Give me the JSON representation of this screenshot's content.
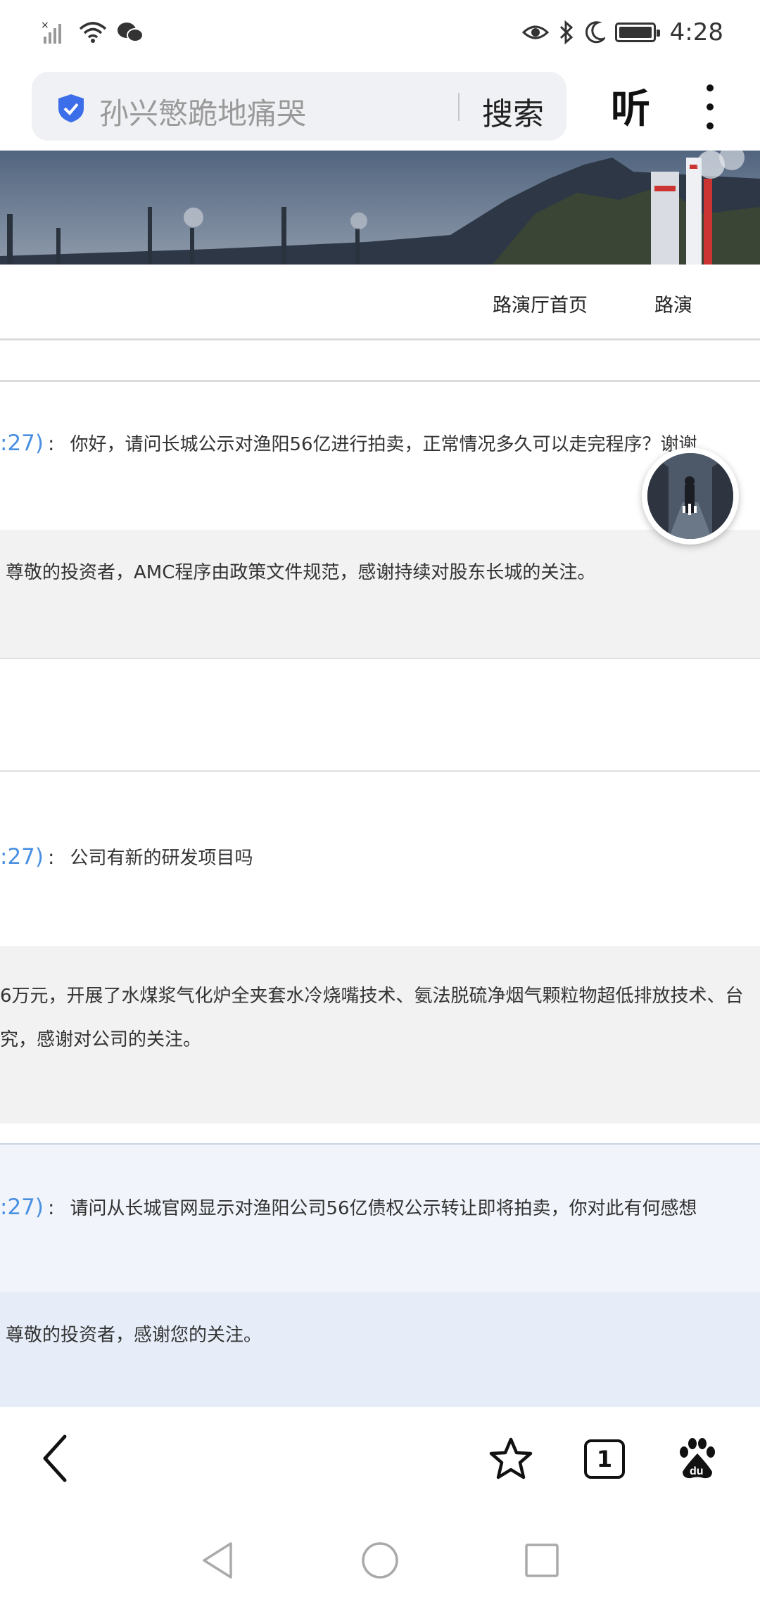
{
  "status_bar": {
    "time": "4:28",
    "left_icons": [
      "signal-icon",
      "wifi-icon",
      "wechat-icon"
    ],
    "right_icons": [
      "eye-icon",
      "bluetooth-icon",
      "moon-icon",
      "battery-icon"
    ]
  },
  "search": {
    "query": "孙兴慜跪地痛哭",
    "button_label": "搜索",
    "listen_label": "听"
  },
  "nav": {
    "items": [
      "路演厅首页",
      "路演"
    ]
  },
  "qa": [
    {
      "id": ":27)",
      "colon": ":",
      "question": "你好，请问长城公示对渔阳56亿进行拍卖，正常情况多久可以走完程序？谢谢",
      "answer_lines": [
        "尊敬的投资者，AMC程序由政策文件规范，感谢持续对股东长城的关注。"
      ]
    },
    {
      "id": ":27)",
      "colon": ":",
      "question": "公司有新的研发项目吗",
      "answer_lines": [
        "6万元，开展了水煤浆气化炉全夹套水冷烧嘴技术、氨法脱硫净烟气颗粒物超低排放技术、台",
        "究，感谢对公司的关注。"
      ]
    },
    {
      "id": ":27)",
      "colon": ":",
      "question": "请问从长城官网显示对渔阳公司56亿债权公示转让即将拍卖，你对此有何感想",
      "answer_lines": [
        "尊敬的投资者，感谢您的关注。"
      ]
    }
  ],
  "bottom_bar": {
    "tab_count": "1",
    "icons": [
      "back-icon",
      "star-icon",
      "tabs-icon",
      "baidu-icon"
    ]
  },
  "colors": {
    "link_blue": "#4a90e2",
    "answer_bg": "#f2f2f2",
    "highlight_question_bg": "#f1f5fb",
    "highlight_answer_bg": "#e6edf8"
  }
}
